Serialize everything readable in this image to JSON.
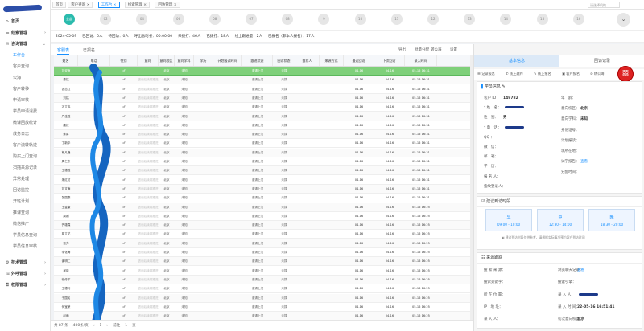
{
  "sidebar": {
    "items": [
      {
        "label": "首页",
        "level": "grp",
        "arrow": ""
      },
      {
        "label": "线索管理",
        "level": "grp",
        "arrow": "›"
      },
      {
        "label": "咨询管理",
        "level": "grp",
        "arrow": "⌄"
      },
      {
        "label": "工作台",
        "level": "sub",
        "active": true
      },
      {
        "label": "客户查询",
        "level": "sub"
      },
      {
        "label": "公海",
        "level": "sub"
      },
      {
        "label": "客户转移",
        "level": "sub"
      },
      {
        "label": "申请审核",
        "level": "sub"
      },
      {
        "label": "学员申请退费",
        "level": "sub"
      },
      {
        "label": "微课回放统计",
        "level": "sub"
      },
      {
        "label": "教务日志",
        "level": "sub"
      },
      {
        "label": "客户流转轨迹",
        "level": "sub"
      },
      {
        "label": "购买上门查询",
        "level": "sub"
      },
      {
        "label": "扫描来源记录",
        "level": "sub"
      },
      {
        "label": "异常处理",
        "level": "sub"
      },
      {
        "label": "回访监控",
        "level": "sub"
      },
      {
        "label": "开班计划",
        "level": "sub"
      },
      {
        "label": "推课查询",
        "level": "sub"
      },
      {
        "label": "微信推广",
        "level": "sub"
      },
      {
        "label": "学员信息查询",
        "level": "sub"
      },
      {
        "label": "学员信息审核",
        "level": "sub"
      },
      {
        "label": "技术管理",
        "level": "grp",
        "arrow": "›"
      },
      {
        "label": "外呼管理",
        "level": "grp",
        "arrow": "›"
      },
      {
        "label": "权限管理",
        "level": "grp",
        "arrow": "›"
      }
    ]
  },
  "page_tabs": [
    {
      "label": "首页",
      "active": false
    },
    {
      "label": "客户查询 ×",
      "active": false
    },
    {
      "label": "工作台 ×",
      "active": true
    },
    {
      "label": "线索管理 ×",
      "active": false
    },
    {
      "label": "回访管理 ×",
      "active": false
    }
  ],
  "tab_search_placeholder": "请选择机构",
  "stages": [
    "全部",
    "02",
    "04",
    "06",
    "08",
    "07",
    "08",
    "9",
    "10",
    "11",
    "12",
    "13",
    "14",
    "15",
    "16"
  ],
  "stage_toggle": "⌄",
  "summary": [
    "2024-05-09",
    "已回访：0人",
    "待回访：0人",
    "呼出总时长：00:00:00",
    "未拨打：46人",
    "已拨打：18人",
    "线上跟进量：2人",
    "已报名（非本人报名）：17人"
  ],
  "content_tabs": [
    "客服表",
    "已报名"
  ],
  "toolbar": [
    "导出",
    "批量分配",
    "转公海",
    "设置"
  ],
  "table": {
    "columns": [
      "姓名",
      "电话",
      "性别",
      "意向",
      "意向校区",
      "意向学科",
      "学历",
      "计划报读时间",
      "跟进状态",
      "回访状态",
      "推荐人",
      "来源方式",
      "最近回访",
      "下次回访",
      "录入时间"
    ],
    "rows": [
      {
        "name": "刘双雨",
        "gender": "♂",
        "hint": "",
        "school": "北京",
        "subject": "未知",
        "status": "邀请上门",
        "visit": "未拨",
        "last": "04-16",
        "next": "04-16",
        "created": "05-16 16:31"
      },
      {
        "name": "秦铭",
        "gender": "♂",
        "hint": "咨询后续再跟进",
        "school": "北京",
        "subject": "未知",
        "status": "邀请上门",
        "visit": "未拨",
        "last": "04-16",
        "next": "04-16",
        "created": "05-16 16:31"
      },
      {
        "name": "张志红",
        "gender": "♂",
        "hint": "咨询后续再跟进",
        "school": "北京",
        "subject": "未知",
        "status": "邀请上门",
        "visit": "未拨",
        "last": "04-16",
        "next": "04-16",
        "created": "05-16 16:31"
      },
      {
        "name": "刘铭",
        "gender": "♂",
        "hint": "咨询后续再跟进",
        "school": "北京",
        "subject": "未知",
        "status": "邀请上门",
        "visit": "未拨",
        "last": "04-16",
        "next": "04-16",
        "created": "05-16 16:31"
      },
      {
        "name": "冯立伟",
        "gender": "♂",
        "hint": "咨询后续再跟进",
        "school": "北京",
        "subject": "未知",
        "status": "邀请上门",
        "visit": "未拨",
        "last": "04-16",
        "next": "04-16",
        "created": "05-16 16:31"
      },
      {
        "name": "严佳胜",
        "gender": "♂",
        "hint": "咨询后续再跟进",
        "school": "北京",
        "subject": "未知",
        "status": "邀请上门",
        "visit": "未拨",
        "last": "04-16",
        "next": "04-16",
        "created": "05-16 16:31"
      },
      {
        "name": "唐红",
        "gender": "♂",
        "hint": "咨询后续再跟进",
        "school": "北京",
        "subject": "未知",
        "status": "邀请上门",
        "visit": "未拨",
        "last": "04-16",
        "next": "04-16",
        "created": "05-16 16:31"
      },
      {
        "name": "朱喜",
        "gender": "♂",
        "hint": "咨询后续再跟进",
        "school": "北京",
        "subject": "未知",
        "status": "邀请上门",
        "visit": "未拨",
        "last": "04-16",
        "next": "04-16",
        "created": "05-16 16:31"
      },
      {
        "name": "丁新华",
        "gender": "♂",
        "hint": "咨询后续再跟进",
        "school": "北京",
        "subject": "未知",
        "status": "邀请上门",
        "visit": "未拨",
        "last": "04-16",
        "next": "04-16",
        "created": "05-16 16:31"
      },
      {
        "name": "杨凡峰",
        "gender": "♂",
        "hint": "咨询后续再跟进",
        "school": "北京",
        "subject": "未知",
        "status": "邀请上门",
        "visit": "未拨",
        "last": "04-16",
        "next": "04-16",
        "created": "05-16 16:31"
      },
      {
        "name": "周仁东",
        "gender": "♂",
        "hint": "咨询后续再跟进",
        "school": "北京",
        "subject": "未知",
        "status": "邀请上门",
        "visit": "未拨",
        "last": "04-16",
        "next": "04-16",
        "created": "05-16 16:31"
      },
      {
        "name": "王德胜",
        "gender": "♂",
        "hint": "咨询后续再跟进",
        "school": "北京",
        "subject": "未知",
        "status": "邀请上门",
        "visit": "未拨",
        "last": "04-16",
        "next": "04-16",
        "created": "05-16 16:31"
      },
      {
        "name": "朱红坊",
        "gender": "♂",
        "hint": "咨询后续再跟进",
        "school": "北京",
        "subject": "未知",
        "status": "邀请上门",
        "visit": "未拨",
        "last": "04-16",
        "next": "04-16",
        "created": "05-16 16:31"
      },
      {
        "name": "刘文涛",
        "gender": "♂",
        "hint": "咨询后续再跟进",
        "school": "北京",
        "subject": "未知",
        "status": "邀请上门",
        "visit": "未拨",
        "last": "04-16",
        "next": "04-16",
        "created": "05-16 16:31"
      },
      {
        "name": "张国康",
        "gender": "♂",
        "hint": "咨询后续再跟进",
        "school": "北京",
        "subject": "未知",
        "status": "邀请上门",
        "visit": "未拨",
        "last": "04-16",
        "next": "04-16",
        "created": "05-16 16:31"
      },
      {
        "name": "王金康",
        "gender": "♂",
        "hint": "咨询后续再跟进",
        "school": "北京",
        "subject": "未知",
        "status": "邀请上门",
        "visit": "未拨",
        "last": "04-16",
        "next": "04-16",
        "created": "05-16 16:25"
      },
      {
        "name": "周刚",
        "gender": "♂",
        "hint": "咨询后续再跟进",
        "school": "北京",
        "subject": "未知",
        "status": "邀请上门",
        "visit": "未拨",
        "last": "04-16",
        "next": "04-16",
        "created": "05-16 16:25"
      },
      {
        "name": "齐雄霖",
        "gender": "♂",
        "hint": "咨询后续再跟进",
        "school": "北京",
        "subject": "未知",
        "status": "邀请上门",
        "visit": "未拨",
        "last": "04-16",
        "next": "04-16",
        "created": "05-16 16:25"
      },
      {
        "name": "夏立花",
        "gender": "♂",
        "hint": "咨询后续再跟进",
        "school": "北京",
        "subject": "未知",
        "status": "邀请上门",
        "visit": "未拨",
        "last": "04-16",
        "next": "04-16",
        "created": "05-16 16:25"
      },
      {
        "name": "张力",
        "gender": "♂",
        "hint": "咨询后续再跟进",
        "school": "北京",
        "subject": "未知",
        "status": "邀请上门",
        "visit": "未拨",
        "last": "04-16",
        "next": "04-16",
        "created": "05-16 16:25"
      },
      {
        "name": "李化涛",
        "gender": "♂",
        "hint": "咨询后续再跟进",
        "school": "北京",
        "subject": "未知",
        "status": "邀请上门",
        "visit": "未拨",
        "last": "04-16",
        "next": "04-16",
        "created": "05-16 16:25"
      },
      {
        "name": "谢明仁",
        "gender": "♂",
        "hint": "咨询后续再跟进",
        "school": "北京",
        "subject": "未知",
        "status": "邀请上门",
        "visit": "未拨",
        "last": "04-16",
        "next": "04-16",
        "created": "05-16 16:25"
      },
      {
        "name": "吴晓",
        "gender": "♂",
        "hint": "咨询后续再跟进",
        "school": "北京",
        "subject": "未知",
        "status": "邀请上门",
        "visit": "未拨",
        "last": "04-16",
        "next": "04-16",
        "created": "05-16 16:25"
      },
      {
        "name": "徐传军",
        "gender": "♂",
        "hint": "咨询后续再跟进",
        "school": "北京",
        "subject": "未知",
        "status": "邀请上门",
        "visit": "未拨",
        "last": "04-16",
        "next": "04-16",
        "created": "05-16 16:25"
      },
      {
        "name": "王德利",
        "gender": "♂",
        "hint": "咨询后续再跟进",
        "school": "北京",
        "subject": "未知",
        "status": "邀请上门",
        "visit": "未拨",
        "last": "04-16",
        "next": "04-16",
        "created": "05-16 16:25"
      },
      {
        "name": "于国民",
        "gender": "♂",
        "hint": "咨询后续再跟进",
        "school": "北京",
        "subject": "未知",
        "status": "邀请上门",
        "visit": "未拨",
        "last": "04-16",
        "next": "04-16",
        "created": "05-16 16:25"
      },
      {
        "name": "何宝荣",
        "gender": "♂",
        "hint": "咨询后续再跟进",
        "school": "北京",
        "subject": "未知",
        "status": "邀请上门",
        "visit": "未拨",
        "last": "04-16",
        "next": "04-16",
        "created": "05-16 16:25"
      },
      {
        "name": "赵雨",
        "gender": "♂",
        "hint": "咨询后续再跟进",
        "school": "北京",
        "subject": "未知",
        "status": "邀请上门",
        "visit": "未拨",
        "last": "04-16",
        "next": "04-16",
        "created": "05-16 16:25"
      }
    ]
  },
  "pagination": [
    "共 87 条",
    "400条/页",
    "‹",
    "1",
    "›",
    "前往",
    "1",
    "页"
  ],
  "right_panel": {
    "tabs": [
      "基本信息",
      "回访记录"
    ],
    "nav": [
      "☰ 记录报名",
      "✆ 线上邀约",
      "✎ 线上报名",
      "▣ 客户报名",
      "⊘ 转公海"
    ],
    "stamp": "囍",
    "card1_title": "学员信息 ✎",
    "fields_left": [
      {
        "k": "客户 ID：",
        "v": "149782",
        "redact": false
      },
      {
        "k": "* 姓　名：",
        "v": "",
        "redact": true
      },
      {
        "k": "性　别：",
        "v": "男",
        "redact": false
      },
      {
        "k": "* 电　话：",
        "v": "",
        "redact": true
      },
      {
        "k": "QQ ：",
        "v": "-",
        "redact": false
      },
      {
        "k": "微　信：",
        "v": "",
        "redact": false
      },
      {
        "k": "邮　箱：",
        "v": "",
        "redact": false
      },
      {
        "k": "学　历：",
        "v": "",
        "redact": false
      },
      {
        "k": "报 名 人：",
        "v": "",
        "redact": false
      },
      {
        "k": "指纹登录人：",
        "v": "",
        "redact": false
      }
    ],
    "fields_right": [
      {
        "k": "年　龄：",
        "v": "",
        "link": false
      },
      {
        "k": "意向校区：",
        "v": "北京",
        "link": false
      },
      {
        "k": "意向学科：",
        "v": "未知",
        "link": false
      },
      {
        "k": "身份证号：",
        "v": "",
        "link": false
      },
      {
        "k": "计划报读：",
        "v": "",
        "link": false
      },
      {
        "k": "现所在地：",
        "v": "",
        "link": false
      },
      {
        "k": "试学报告：",
        "v": "查看",
        "link": true
      },
      {
        "k": "分配时间：",
        "v": "",
        "link": false
      }
    ],
    "card2_title": "☑ 建议到访时段",
    "slots": [
      {
        "name": "早",
        "time": "09:00 - 10:00"
      },
      {
        "name": "中",
        "time": "12:30 - 14:00"
      },
      {
        "name": "晚",
        "time": "18:30 - 20:00"
      }
    ],
    "slot_note": "▣ 建议到访时段仅供参考，请根据实际情况预约客户到访时间",
    "card3_title": "☷ 来源跟踪",
    "source_left": [
      {
        "k": "搜 索 来 源：",
        "v": ""
      },
      {
        "k": "搜索关键字：",
        "v": ""
      },
      {
        "k": "所 在 位 置：",
        "v": ""
      },
      {
        "k": "IP　地 址：",
        "v": ""
      },
      {
        "k": "录 入 人：",
        "v": ""
      }
    ],
    "source_right": [
      {
        "k": "浏览聊天记录：",
        "v": "查看",
        "link": true
      },
      {
        "k": "搜索引擎：",
        "v": ""
      },
      {
        "k": "录 入 人：",
        "v": "",
        "redact": true
      },
      {
        "k": "录 入 时 间：",
        "v": "22-05-16 16:51:41"
      },
      {
        "k": "初次意向校区：",
        "v": "北京"
      }
    ]
  }
}
